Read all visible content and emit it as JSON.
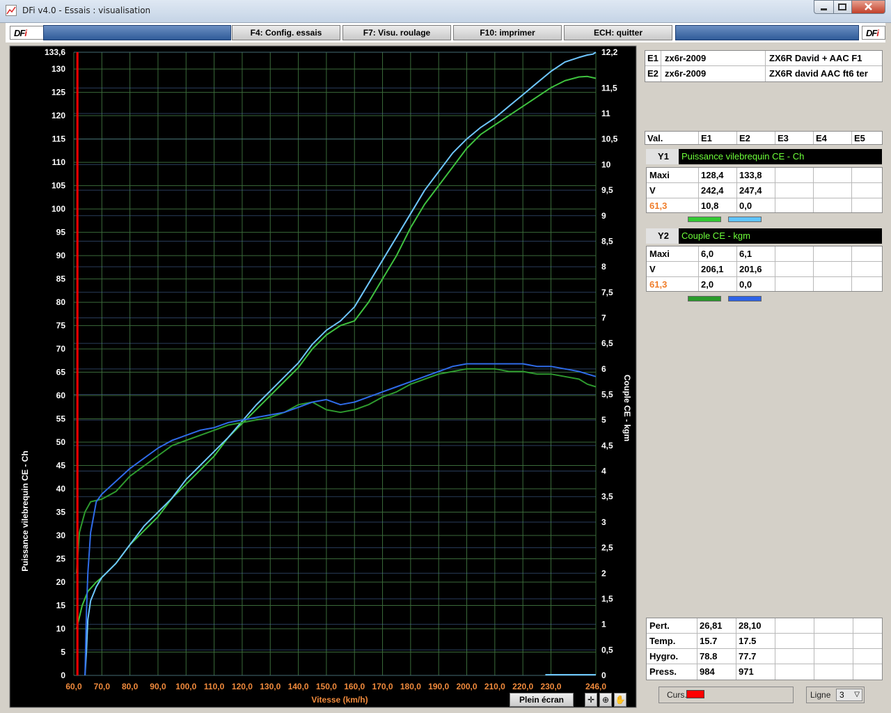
{
  "window": {
    "title": "DFi v4.0 - Essais : visualisation"
  },
  "toolbar": {
    "logo_text": "DF",
    "logo_mark": "i",
    "f4_label": "F4: Config. essais",
    "f7_label": "F7: Visu. roulage",
    "f10_label": "F10: imprimer",
    "ech_label": "ECH: quitter"
  },
  "chart_data": {
    "type": "line",
    "xlabel": "Vitesse (km/h)",
    "ylabel": "Puissance vilebrequin CE - Ch",
    "y2label": "Couple CE - kgm",
    "xlim": [
      60.0,
      246.0
    ],
    "ylim": [
      0,
      133.6
    ],
    "y2lim": [
      0,
      12.2
    ],
    "x_ticks": [
      "60,0",
      "70,0",
      "80,0",
      "90,0",
      "100,0",
      "110,0",
      "120,0",
      "130,0",
      "140,0",
      "150,0",
      "160,0",
      "170,0",
      "180,0",
      "190,0",
      "200,0",
      "210,0",
      "220,0",
      "230,0",
      "246,0"
    ],
    "y_ticks": [
      "0",
      "5",
      "10",
      "15",
      "20",
      "25",
      "30",
      "35",
      "40",
      "45",
      "50",
      "55",
      "60",
      "65",
      "70",
      "75",
      "80",
      "85",
      "90",
      "95",
      "100",
      "105",
      "110",
      "115",
      "120",
      "125",
      "130",
      "133,6"
    ],
    "y2_ticks": [
      "0",
      "0,5",
      "1",
      "1,5",
      "2",
      "2,5",
      "3",
      "3,5",
      "4",
      "4,5",
      "5",
      "5,5",
      "6",
      "6,5",
      "7",
      "7,5",
      "8",
      "8,5",
      "9",
      "9,5",
      "10",
      "10,5",
      "11",
      "11,5",
      "12,2"
    ],
    "cursor_x": 61.3,
    "grid": true,
    "colors": {
      "background": "#000000",
      "grid": "#3a6a3a",
      "cursor": "#ff0000"
    },
    "series": [
      {
        "name": "E1",
        "axis": "y",
        "color": "#3fc23f",
        "x": [
          61,
          63,
          65,
          68,
          70,
          75,
          80,
          85,
          90,
          95,
          100,
          105,
          110,
          115,
          120,
          125,
          130,
          135,
          140,
          145,
          150,
          155,
          160,
          165,
          170,
          175,
          180,
          185,
          190,
          195,
          200,
          205,
          210,
          215,
          220,
          225,
          230,
          235,
          240,
          243,
          246
        ],
        "y": [
          10,
          15,
          18,
          20,
          21,
          24,
          28,
          31,
          34,
          38,
          41,
          44,
          47,
          51,
          54,
          57,
          60,
          63,
          66,
          70,
          73,
          75,
          76,
          80,
          85,
          90,
          96,
          101,
          105,
          109,
          113,
          116,
          118,
          120,
          122,
          124,
          126,
          127.5,
          128.3,
          128.4,
          128
        ]
      },
      {
        "name": "E2",
        "axis": "y",
        "color": "#6ec6ff",
        "x": [
          64,
          64.5,
          65,
          66,
          68,
          70,
          75,
          80,
          85,
          90,
          95,
          100,
          105,
          110,
          115,
          120,
          125,
          130,
          135,
          140,
          145,
          150,
          155,
          160,
          165,
          170,
          175,
          180,
          185,
          190,
          195,
          200,
          205,
          210,
          215,
          220,
          225,
          230,
          235,
          240,
          243,
          245,
          246
        ],
        "y": [
          0,
          5,
          12,
          16,
          19,
          21,
          24,
          28,
          32,
          35,
          38,
          42,
          45,
          48,
          51,
          54.5,
          58,
          61,
          64,
          67,
          71,
          74,
          76,
          79,
          84,
          89,
          94,
          99,
          104,
          108,
          112,
          115,
          117.5,
          119.5,
          122,
          124.5,
          127,
          129.5,
          131.5,
          132.5,
          133,
          133.2,
          133.6
        ]
      },
      {
        "name": "E1",
        "axis": "y2",
        "color": "#2e9a2e",
        "x": [
          61,
          62,
          64,
          66,
          70,
          75,
          80,
          85,
          90,
          95,
          100,
          105,
          110,
          115,
          120,
          125,
          130,
          135,
          140,
          145,
          150,
          155,
          160,
          165,
          170,
          175,
          180,
          185,
          190,
          195,
          200,
          205,
          210,
          215,
          220,
          225,
          230,
          235,
          240,
          243,
          246
        ],
        "y": [
          2.0,
          2.8,
          3.2,
          3.4,
          3.45,
          3.6,
          3.9,
          4.1,
          4.3,
          4.5,
          4.6,
          4.7,
          4.8,
          4.9,
          4.95,
          5.0,
          5.05,
          5.15,
          5.3,
          5.35,
          5.2,
          5.15,
          5.2,
          5.3,
          5.45,
          5.55,
          5.7,
          5.8,
          5.9,
          5.95,
          6.0,
          6.0,
          6.0,
          5.95,
          5.95,
          5.9,
          5.9,
          5.85,
          5.8,
          5.7,
          5.65
        ]
      },
      {
        "name": "E2",
        "axis": "y2",
        "color": "#2f6be8",
        "x": [
          64,
          64.5,
          65,
          66,
          68,
          70,
          75,
          80,
          85,
          90,
          95,
          100,
          105,
          110,
          115,
          120,
          125,
          130,
          135,
          140,
          145,
          150,
          155,
          160,
          165,
          170,
          175,
          180,
          185,
          190,
          195,
          200,
          205,
          210,
          215,
          220,
          225,
          230,
          235,
          240,
          243,
          246
        ],
        "y": [
          0,
          1.2,
          2.0,
          2.8,
          3.4,
          3.55,
          3.8,
          4.05,
          4.25,
          4.45,
          4.6,
          4.7,
          4.8,
          4.85,
          4.95,
          5.0,
          5.05,
          5.1,
          5.15,
          5.25,
          5.35,
          5.4,
          5.3,
          5.35,
          5.45,
          5.55,
          5.65,
          5.75,
          5.85,
          5.95,
          6.05,
          6.1,
          6.1,
          6.1,
          6.1,
          6.1,
          6.05,
          6.05,
          6.0,
          5.95,
          5.9,
          5.85
        ]
      }
    ]
  },
  "legend": {
    "e1_id": "E1",
    "e1_vehicle": "zx6r-2009",
    "e1_desc": "ZX6R David + AAC F1",
    "e2_id": "E2",
    "e2_vehicle": "zx6r-2009",
    "e2_desc": "ZX6R david AAC ft6 ter"
  },
  "table_header": [
    "Val.",
    "E1",
    "E2",
    "E3",
    "E4",
    "E5"
  ],
  "y1": {
    "tag": "Y1",
    "field": "Puissance vilebrequin CE - Ch",
    "rows": [
      {
        "label": "Maxi",
        "e1": "128,4",
        "e2": "133,8"
      },
      {
        "label": "V",
        "e1": "242,4",
        "e2": "247,4"
      },
      {
        "label": "61,3",
        "e1": "10,8",
        "e2": "0,0"
      }
    ],
    "swatch_e1": "#32c832",
    "swatch_e2": "#5fc4ff"
  },
  "y2": {
    "tag": "Y2",
    "field": "Couple CE - kgm",
    "rows": [
      {
        "label": "Maxi",
        "e1": "6,0",
        "e2": "6,1"
      },
      {
        "label": "V",
        "e1": "206,1",
        "e2": "201,6"
      },
      {
        "label": "61,3",
        "e1": "2,0",
        "e2": "0,0"
      }
    ],
    "swatch_e1": "#2a9a2a",
    "swatch_e2": "#2e63e6"
  },
  "conditions": [
    {
      "label": "Pert.",
      "e1": "26,81",
      "e2": "28,10"
    },
    {
      "label": "Temp.",
      "e1": "15.7",
      "e2": "17.5"
    },
    {
      "label": "Hygro.",
      "e1": "78.8",
      "e2": "77.7"
    },
    {
      "label": "Press.",
      "e1": "984",
      "e2": "971"
    }
  ],
  "bottom": {
    "plein_ecran": "Plein écran",
    "curs_label": "Curs.",
    "ligne_label": "Ligne",
    "ligne_value": "3"
  }
}
